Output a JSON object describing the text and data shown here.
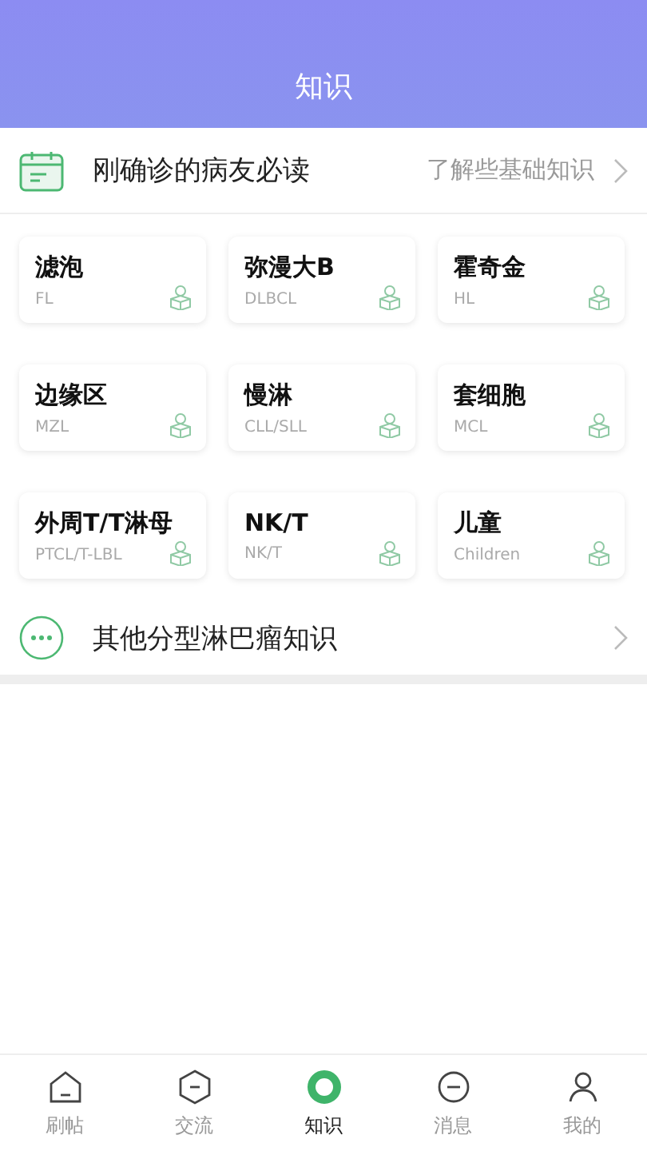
{
  "header": {
    "title": "知识"
  },
  "intro": {
    "title": "刚确诊的病友必读",
    "hint": "了解些基础知识"
  },
  "types": [
    {
      "name": "滤泡",
      "code": "FL"
    },
    {
      "name": "弥漫大B",
      "code": "DLBCL"
    },
    {
      "name": "霍奇金",
      "code": "HL"
    },
    {
      "name": "边缘区",
      "code": "MZL"
    },
    {
      "name": "慢淋",
      "code": "CLL/SLL"
    },
    {
      "name": "套细胞",
      "code": "MCL"
    },
    {
      "name": "外周T/T淋母",
      "code": "PTCL/T-LBL"
    },
    {
      "name": "NK/T",
      "code": "NK/T"
    },
    {
      "name": "儿童",
      "code": "Children"
    }
  ],
  "other": {
    "title": "其他分型淋巴瘤知识"
  },
  "tabs": [
    {
      "label": "刷帖",
      "kind": "home",
      "selected": false
    },
    {
      "label": "交流",
      "kind": "chat",
      "selected": false
    },
    {
      "label": "知识",
      "kind": "knowledge",
      "selected": true
    },
    {
      "label": "消息",
      "kind": "message",
      "selected": false
    },
    {
      "label": "我的",
      "kind": "me",
      "selected": false
    }
  ]
}
